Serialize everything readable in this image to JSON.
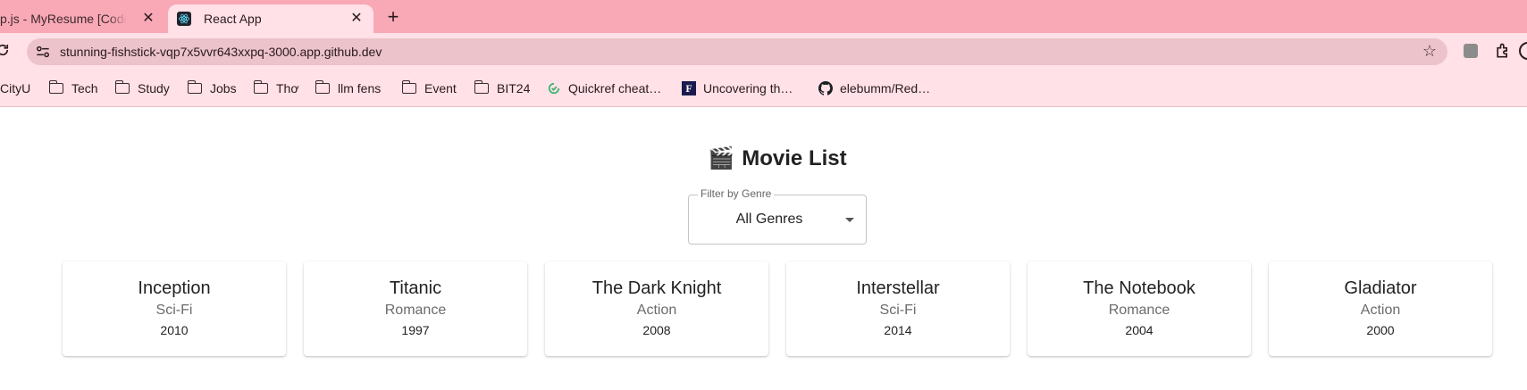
{
  "browser": {
    "tabs": [
      {
        "title": "p.js - MyResume [Codespaces]",
        "active": false
      },
      {
        "title": "React App",
        "active": true
      }
    ],
    "url": "stunning-fishstick-vqp7x5vvr643xxpq-3000.app.github.dev",
    "bookmarks": [
      {
        "label": "CityU",
        "icon": "folder-icon"
      },
      {
        "label": "Tech",
        "icon": "folder-icon"
      },
      {
        "label": "Study",
        "icon": "folder-icon"
      },
      {
        "label": "Jobs",
        "icon": "folder-icon"
      },
      {
        "label": "Thơ",
        "icon": "folder-icon"
      },
      {
        "label": "llm fens",
        "icon": "folder-icon"
      },
      {
        "label": "Event",
        "icon": "folder-icon"
      },
      {
        "label": "BIT24",
        "icon": "folder-icon"
      },
      {
        "label": "Quickref cheat…",
        "icon": "quickref-icon"
      },
      {
        "label": "Uncovering th…",
        "icon": "f-logo-icon"
      },
      {
        "label": "elebumm/Red…",
        "icon": "github-icon"
      }
    ]
  },
  "app": {
    "title": "Movie List",
    "title_emoji": "🎬",
    "filter": {
      "label": "Filter by Genre",
      "value": "All Genres"
    },
    "movies": [
      {
        "title": "Inception",
        "genre": "Sci-Fi",
        "year": "2010"
      },
      {
        "title": "Titanic",
        "genre": "Romance",
        "year": "1997"
      },
      {
        "title": "The Dark Knight",
        "genre": "Action",
        "year": "2008"
      },
      {
        "title": "Interstellar",
        "genre": "Sci-Fi",
        "year": "2014"
      },
      {
        "title": "The Notebook",
        "genre": "Romance",
        "year": "2004"
      },
      {
        "title": "Gladiator",
        "genre": "Action",
        "year": "2000"
      }
    ]
  },
  "colors": {
    "tabstrip": "#f9a8b6",
    "toolbar": "#ffe1e7",
    "omnibox": "#ecc3cb"
  }
}
